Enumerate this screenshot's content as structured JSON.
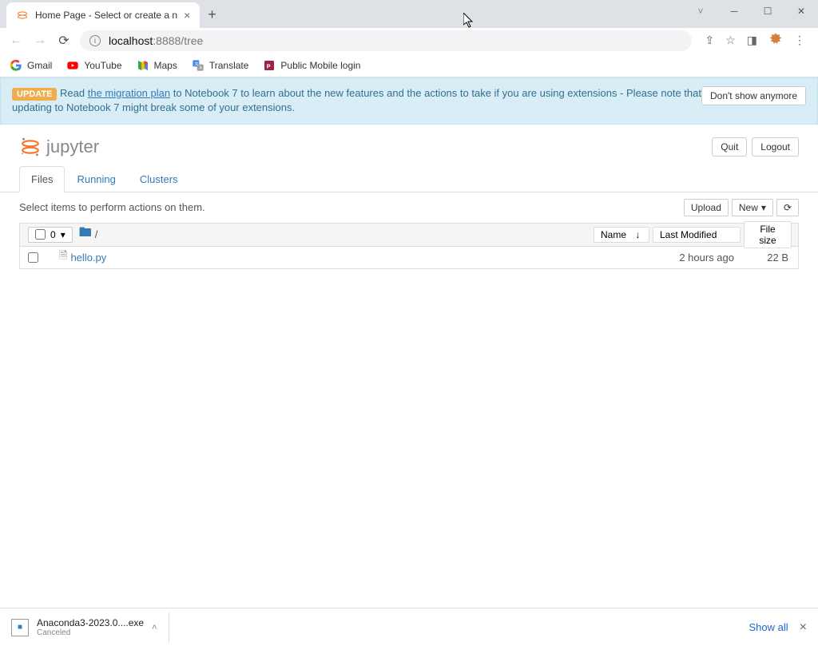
{
  "browser": {
    "tab_title": "Home Page - Select or create a n",
    "url_domain": "localhost",
    "url_port_path": ":8888/tree"
  },
  "bookmarks": [
    {
      "label": "Gmail"
    },
    {
      "label": "YouTube"
    },
    {
      "label": "Maps"
    },
    {
      "label": "Translate"
    },
    {
      "label": "Public Mobile login"
    }
  ],
  "banner": {
    "badge": "UPDATE",
    "pre": "Read ",
    "link": "the migration plan",
    "post": " to Notebook 7 to learn about the new features and the actions to take if you are using extensions - Please note that updating to Notebook 7 might break some of your extensions.",
    "dismiss": "Don't show anymore"
  },
  "header": {
    "logo_text": "jupyter",
    "quit": "Quit",
    "logout": "Logout"
  },
  "tabs": [
    "Files",
    "Running",
    "Clusters"
  ],
  "toolbar": {
    "hint": "Select items to perform actions on them.",
    "upload": "Upload",
    "new": "New",
    "select_count": "0"
  },
  "columns": {
    "name": "Name",
    "modified": "Last Modified",
    "size": "File size"
  },
  "breadcrumb": "/",
  "files": [
    {
      "name": "hello.py",
      "modified": "2 hours ago",
      "size": "22 B"
    }
  ],
  "download": {
    "filename": "Anaconda3-2023.0....exe",
    "status": "Canceled",
    "show_all": "Show all"
  }
}
